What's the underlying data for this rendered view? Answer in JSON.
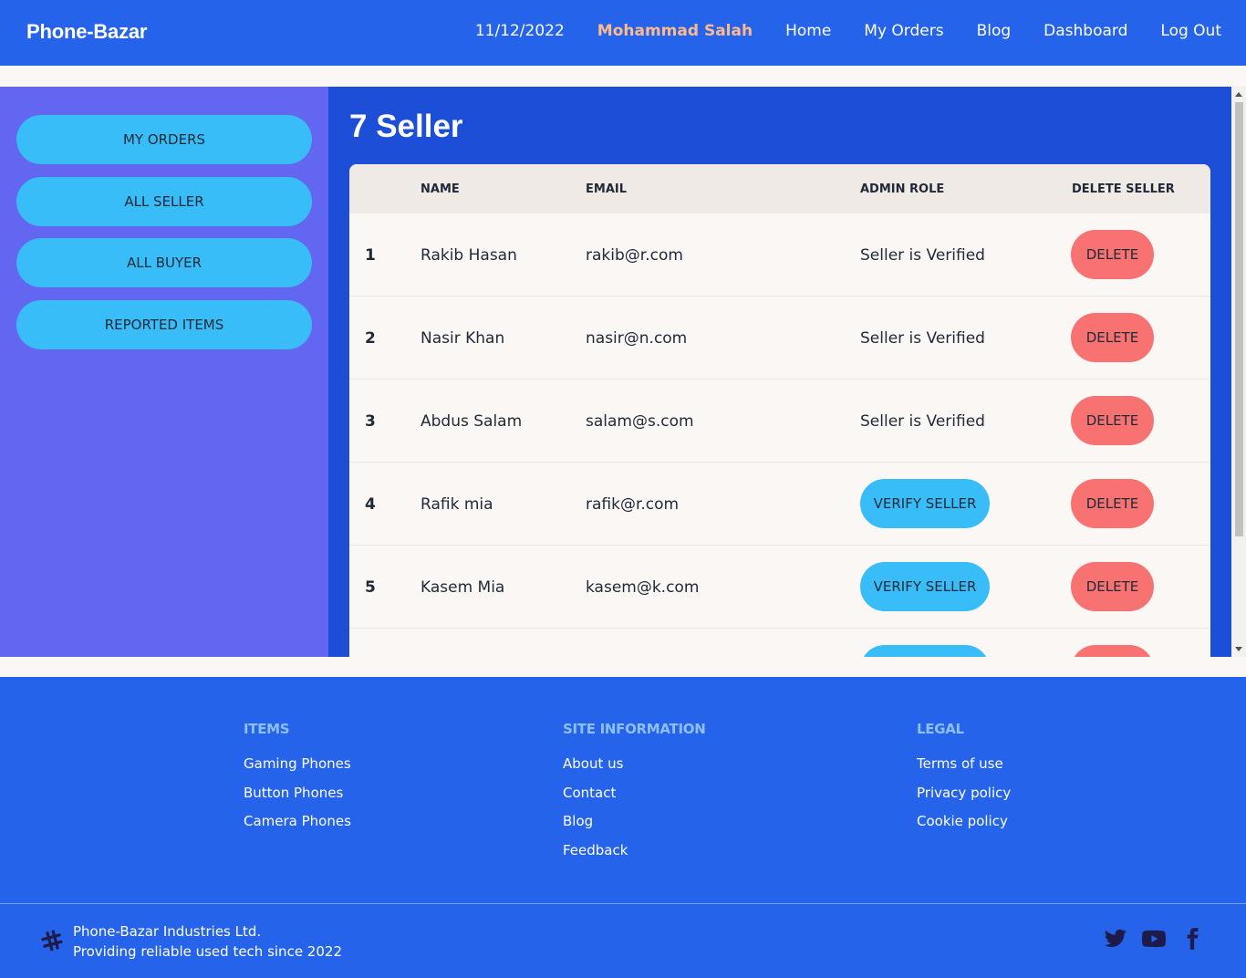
{
  "navbar": {
    "brand": "Phone-Bazar",
    "date": "11/12/2022",
    "user": "Mohammad Salah",
    "links": [
      "Home",
      "My Orders",
      "Blog",
      "Dashboard",
      "Log Out"
    ],
    "user_color": "#fdba8c"
  },
  "sidebar": {
    "items": [
      "MY ORDERS",
      "ALL SELLER",
      "ALL BUYER",
      "REPORTED ITEMS"
    ]
  },
  "main": {
    "title": "7 Seller",
    "table": {
      "headers": [
        "NAME",
        "EMAIL",
        "ADMIN ROLE",
        "DELETE SELLER"
      ],
      "rows": [
        {
          "index": "1",
          "name": "Rakib Hasan",
          "email": "rakib@r.com",
          "role": "Seller is Verified",
          "verified": true
        },
        {
          "index": "2",
          "name": "Nasir Khan",
          "email": "nasir@n.com",
          "role": "Seller is Verified",
          "verified": true
        },
        {
          "index": "3",
          "name": "Abdus Salam",
          "email": "salam@s.com",
          "role": "Seller is Verified",
          "verified": true
        },
        {
          "index": "4",
          "name": "Rafik mia",
          "email": "rafik@r.com",
          "role": "VERIFY SELLER",
          "verified": false
        },
        {
          "index": "5",
          "name": "Kasem Mia",
          "email": "kasem@k.com",
          "role": "VERIFY SELLER",
          "verified": false
        }
      ],
      "delete_label": "DELETE",
      "verify_label": "VERIFY SELLER"
    }
  },
  "footer": {
    "columns": [
      {
        "title": "ITEMS",
        "links": [
          "Gaming Phones",
          "Button Phones",
          "Camera Phones"
        ]
      },
      {
        "title": "SITE INFORMATION",
        "links": [
          "About us",
          "Contact",
          "Blog",
          "Feedback"
        ]
      },
      {
        "title": "LEGAL",
        "links": [
          "Terms of use",
          "Privacy policy",
          "Cookie policy"
        ]
      }
    ],
    "company": "Phone-Bazar Industries Ltd.",
    "tagline": "Providing reliable used tech since 2022",
    "socials": [
      "twitter-icon",
      "youtube-icon",
      "facebook-icon"
    ]
  },
  "colors": {
    "primary": "#2563eb",
    "sidebar": "#6366f1",
    "panel": "#1d4ed8",
    "accent": "#38bdf8",
    "error": "#f87272"
  }
}
